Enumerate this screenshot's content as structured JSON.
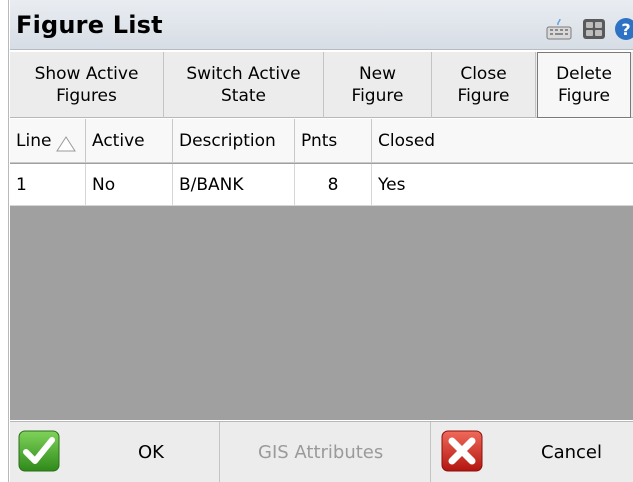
{
  "title": "Figure List",
  "title_icons": [
    "keyboard-icon",
    "calculator-icon",
    "help-icon"
  ],
  "toolbar": {
    "show_active": "Show Active\nFigures",
    "switch_state": "Switch Active\nState",
    "new_figure": "New\nFigure",
    "close_figure": "Close\nFigure",
    "delete_figure": "Delete\nFigure"
  },
  "table": {
    "columns": [
      "Line",
      "Active",
      "Description",
      "Pnts",
      "Closed"
    ],
    "rows": [
      {
        "line": "1",
        "active": "No",
        "description": "B/BANK",
        "pnts": "8",
        "closed": "Yes"
      }
    ]
  },
  "footer": {
    "ok": "OK",
    "gis": "GIS Attributes",
    "cancel": "Cancel"
  },
  "colors": {
    "empty_grid": "#a0a0a0",
    "ok_green": "#3a9b22",
    "cancel_red": "#d0221d"
  }
}
